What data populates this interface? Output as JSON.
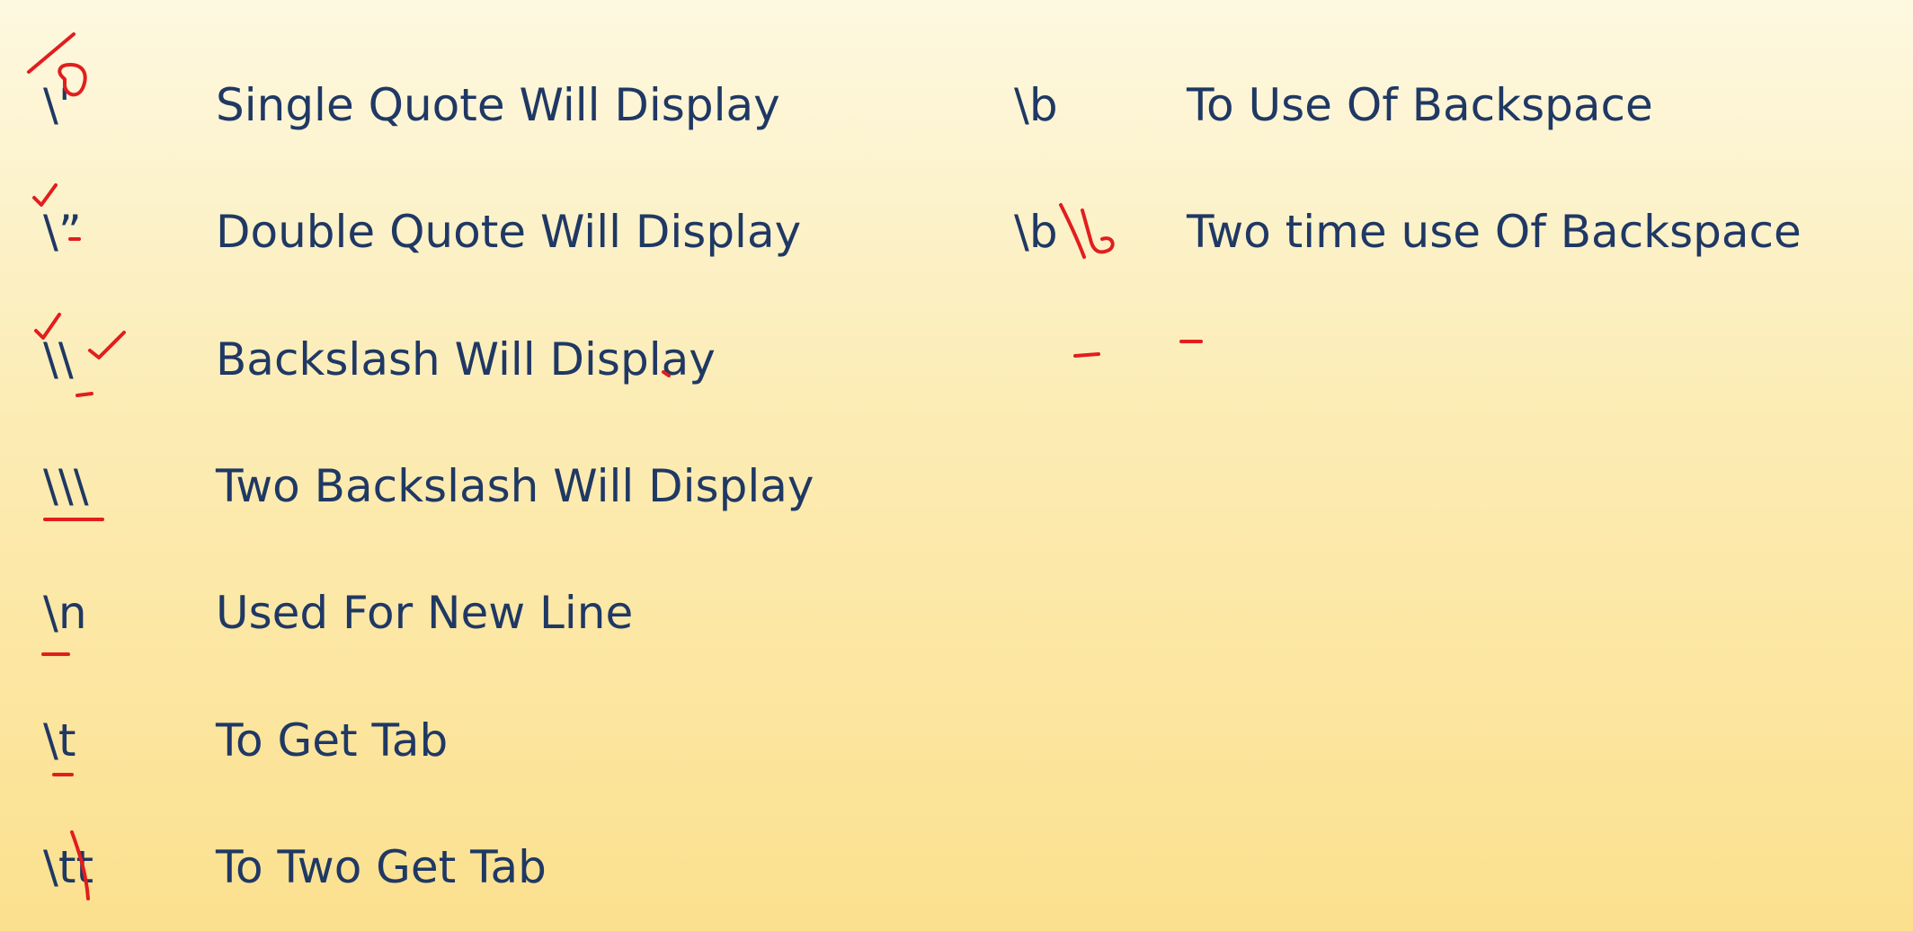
{
  "left_rows": [
    {
      "code": "\\'",
      "desc": "Single Quote Will Display"
    },
    {
      "code": "\\”",
      "desc": "Double Quote Will Display"
    },
    {
      "code": "\\\\",
      "desc": "Backslash Will Display"
    },
    {
      "code": "\\\\\\",
      "desc": "Two Backslash Will Display"
    },
    {
      "code": "\\n",
      "desc": "Used For New Line"
    },
    {
      "code": "\\t",
      "desc": "To Get Tab"
    },
    {
      "code": "\\tt",
      "desc": "To Two Get Tab"
    }
  ],
  "right_rows": [
    {
      "code": "\\b",
      "desc": "To Use Of Backspace"
    },
    {
      "code": "\\b",
      "desc": "Two time use Of Backspace"
    }
  ],
  "colors": {
    "text": "#1f3864",
    "ink": "#e11e1e"
  }
}
